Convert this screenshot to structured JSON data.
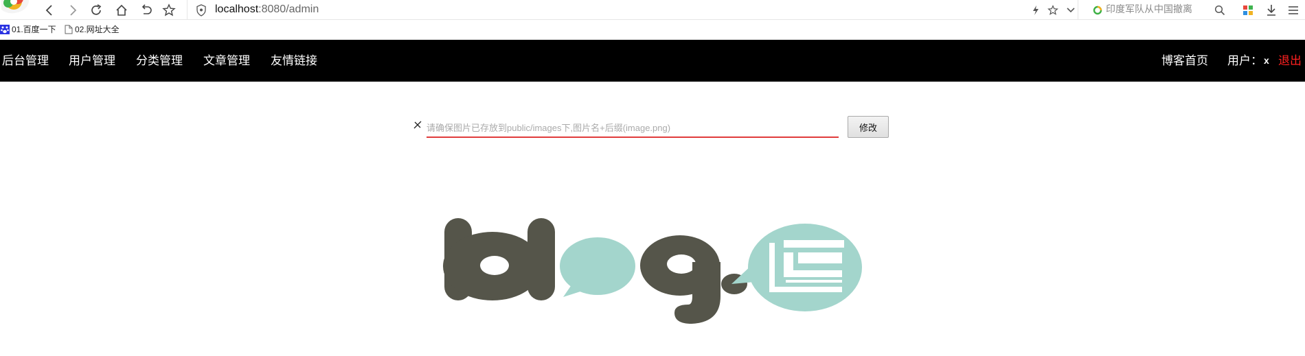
{
  "browser": {
    "url_host": "localhost",
    "url_port": ":8080/admin",
    "search_placeholder": "印度军队从中国撤离",
    "bookmarks": [
      "01.百度一下",
      "02.网址大全"
    ]
  },
  "nav": {
    "left": [
      "后台管理",
      "用户管理",
      "分类管理",
      "文章管理",
      "友情链接"
    ],
    "home": "博客首页",
    "user_label": "用户：",
    "user_name": "x",
    "logout": "退出"
  },
  "form": {
    "placeholder": "请确保图片已存放到public/images下,图片名+后缀(image.png)",
    "value": "",
    "submit_label": "修改"
  },
  "logo": {
    "primary_color": "#55554a",
    "accent_color": "#a3d5cc"
  },
  "colors": {
    "nav_bg": "#000000",
    "logout": "#ff2020",
    "input_underline": "#e03a3a"
  }
}
